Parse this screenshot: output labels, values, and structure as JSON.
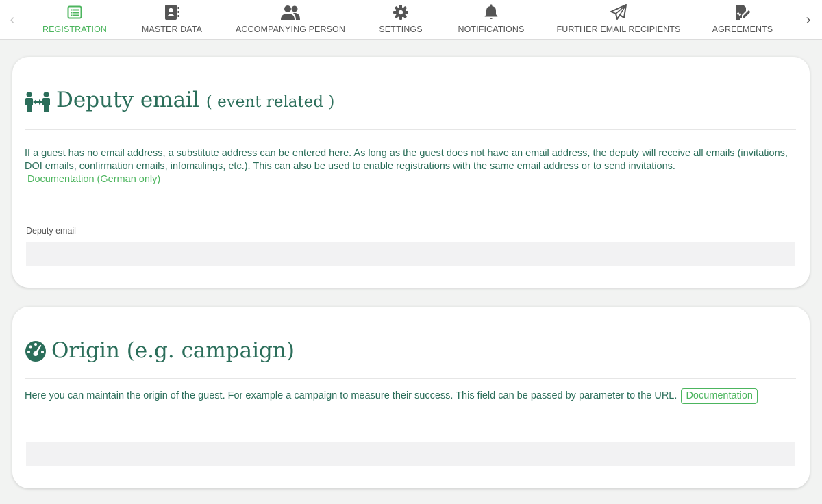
{
  "tabs": [
    {
      "label": "REGISTRATION",
      "icon": "registration-list-icon",
      "active": true
    },
    {
      "label": "MASTER DATA",
      "icon": "contact-card-icon",
      "active": false
    },
    {
      "label": "ACCOMPANYING PERSON",
      "icon": "users-icon",
      "active": false
    },
    {
      "label": "SETTINGS",
      "icon": "gear-icon",
      "active": false
    },
    {
      "label": "NOTIFICATIONS",
      "icon": "bell-icon",
      "active": false
    },
    {
      "label": "FURTHER EMAIL RECIPIENTS",
      "icon": "paper-plane-icon",
      "active": false
    },
    {
      "label": "AGREEMENTS",
      "icon": "signature-icon",
      "active": false
    }
  ],
  "nav": {
    "prev": "‹",
    "next": "›"
  },
  "colors": {
    "accent_green": "#4cb55e",
    "heading_teal": "#2b6e5a",
    "tab_gray": "#555555"
  },
  "deputy": {
    "title": "Deputy email",
    "subtitle": "( event related )",
    "description": "If a guest has no email address, a substitute address can be entered here. As long as the guest does not have an email address, the deputy will receive all emails (invitations, DOI emails, confirmation emails, infomailings, etc.). This can also be used to enable registrations with the same email address or to send invitations.",
    "doc_link": "Documentation (German only)",
    "field_label": "Deputy email",
    "field_value": ""
  },
  "origin": {
    "title": "Origin (e.g. campaign)",
    "description": "Here you can maintain the origin of the guest. For example a campaign to measure their success. This field can be passed by parameter to the URL.",
    "doc_link": "Documentation",
    "field_value": ""
  }
}
